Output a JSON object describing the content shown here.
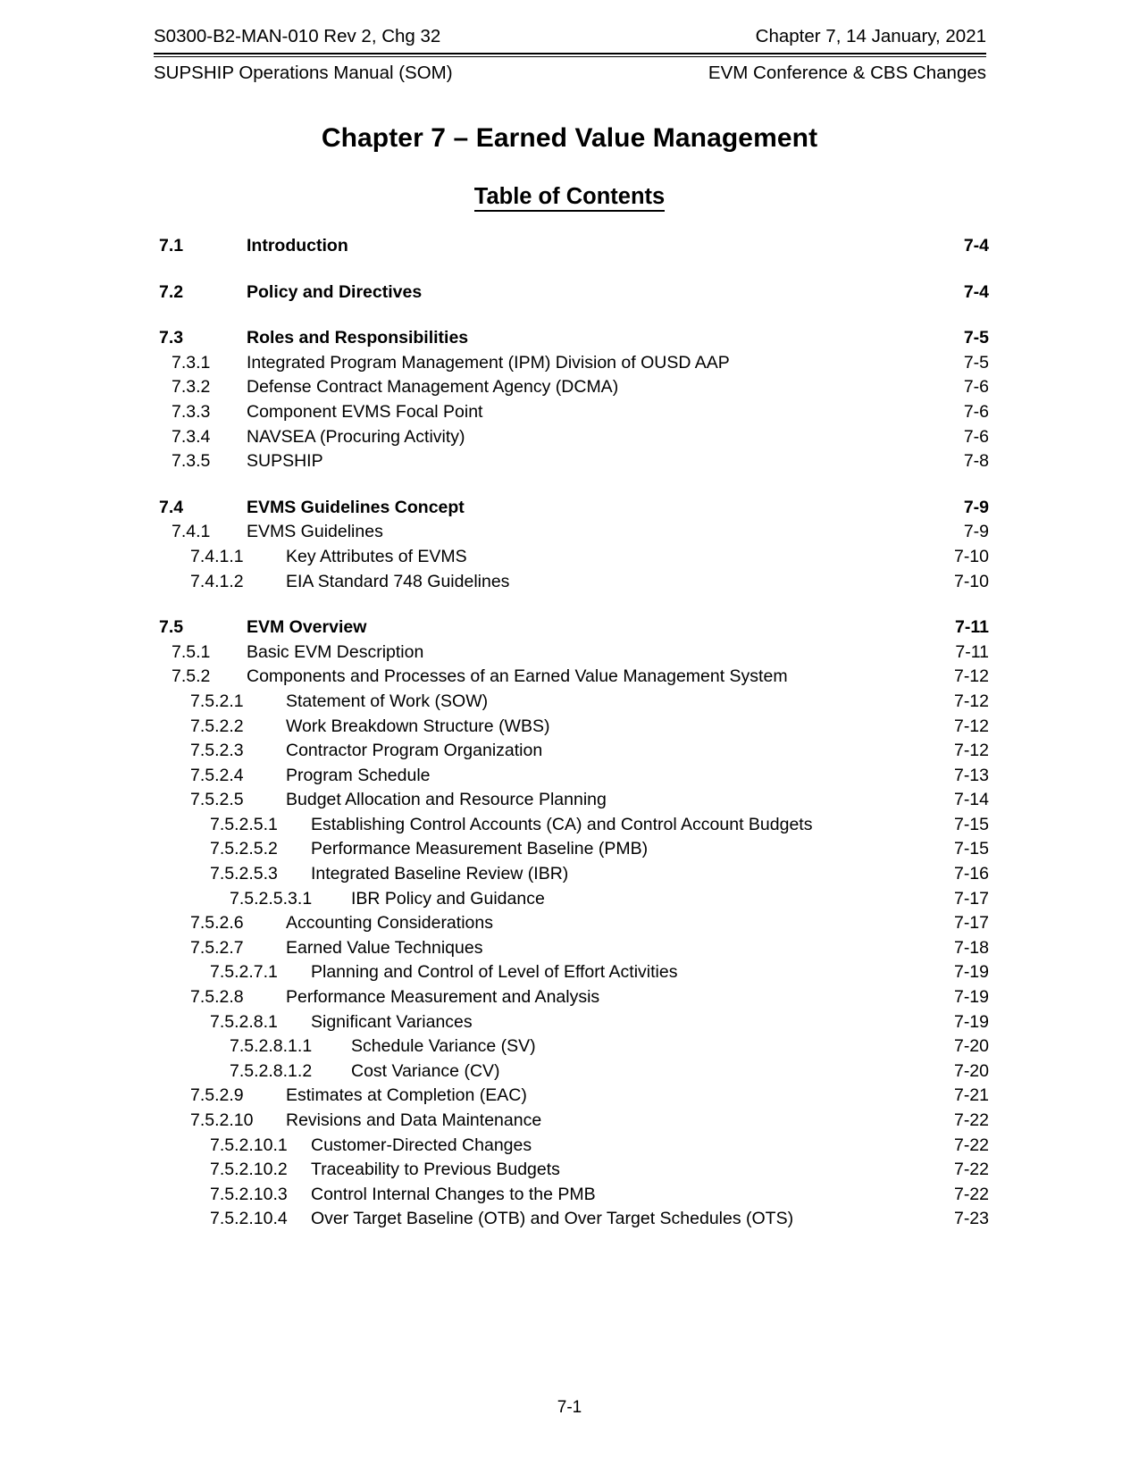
{
  "header": {
    "left_line1": "S0300-B2-MAN-010 Rev 2, Chg 32",
    "right_line1": "Chapter 7, 14 January, 2021",
    "left_line2": "SUPSHIP Operations Manual (SOM)",
    "right_line2": "EVM Conference & CBS Changes"
  },
  "title": {
    "chapter": "Chapter 7 – Earned Value Management",
    "toc_heading": "Table of Contents"
  },
  "toc": {
    "entries": [
      {
        "level": 1,
        "gap": false,
        "number": "7.1",
        "text": "Introduction",
        "page": "7-4"
      },
      {
        "level": 1,
        "gap": true,
        "number": "7.2",
        "text": "Policy and Directives",
        "page": "7-4"
      },
      {
        "level": 1,
        "gap": true,
        "number": "7.3",
        "text": "Roles and Responsibilities",
        "page": "7-5"
      },
      {
        "level": 2,
        "gap": false,
        "number": "7.3.1",
        "text": "Integrated Program Management (IPM) Division of OUSD AAP",
        "page": "7-5"
      },
      {
        "level": 2,
        "gap": false,
        "number": "7.3.2",
        "text": "Defense Contract Management Agency (DCMA)",
        "page": "7-6"
      },
      {
        "level": 2,
        "gap": false,
        "number": "7.3.3",
        "text": "Component EVMS Focal Point",
        "page": "7-6"
      },
      {
        "level": 2,
        "gap": false,
        "number": "7.3.4",
        "text": "NAVSEA (Procuring Activity)",
        "page": "7-6"
      },
      {
        "level": 2,
        "gap": false,
        "number": "7.3.5",
        "text": "SUPSHIP",
        "page": "7-8"
      },
      {
        "level": 1,
        "gap": true,
        "number": "7.4",
        "text": "EVMS Guidelines Concept",
        "page": "7-9"
      },
      {
        "level": 2,
        "gap": false,
        "number": "7.4.1",
        "text": "EVMS Guidelines",
        "page": "7-9"
      },
      {
        "level": 3,
        "gap": false,
        "number": "7.4.1.1",
        "text": "Key Attributes of EVMS",
        "page": "7-10"
      },
      {
        "level": 3,
        "gap": false,
        "number": "7.4.1.2",
        "text": "EIA Standard 748 Guidelines",
        "page": "7-10"
      },
      {
        "level": 1,
        "gap": true,
        "number": "7.5",
        "text": "EVM Overview",
        "page": "7-11"
      },
      {
        "level": 2,
        "gap": false,
        "number": "7.5.1",
        "text": "Basic EVM Description",
        "page": "7-11"
      },
      {
        "level": 2,
        "gap": false,
        "number": "7.5.2",
        "text": "Components and Processes of an Earned Value Management System",
        "page": "7-12"
      },
      {
        "level": 3,
        "gap": false,
        "number": "7.5.2.1",
        "text": "Statement of Work (SOW)",
        "page": "7-12"
      },
      {
        "level": 3,
        "gap": false,
        "number": "7.5.2.2",
        "text": "Work Breakdown Structure (WBS)",
        "page": "7-12"
      },
      {
        "level": 3,
        "gap": false,
        "number": "7.5.2.3",
        "text": "Contractor Program Organization",
        "page": "7-12"
      },
      {
        "level": 3,
        "gap": false,
        "number": "7.5.2.4",
        "text": "Program Schedule",
        "page": "7-13"
      },
      {
        "level": 3,
        "gap": false,
        "number": "7.5.2.5",
        "text": "Budget Allocation and Resource Planning",
        "page": "7-14"
      },
      {
        "level": 4,
        "gap": false,
        "number": "7.5.2.5.1",
        "text": "Establishing Control Accounts (CA) and Control Account Budgets",
        "page": "7-15"
      },
      {
        "level": 4,
        "gap": false,
        "number": "7.5.2.5.2",
        "text": "Performance Measurement Baseline (PMB)",
        "page": "7-15"
      },
      {
        "level": 4,
        "gap": false,
        "number": "7.5.2.5.3",
        "text": "Integrated Baseline Review (IBR)",
        "page": "7-16"
      },
      {
        "level": 5,
        "gap": false,
        "number": "7.5.2.5.3.1",
        "text": "IBR Policy and Guidance",
        "page": "7-17"
      },
      {
        "level": 3,
        "gap": false,
        "number": "7.5.2.6",
        "text": "Accounting Considerations",
        "page": "7-17"
      },
      {
        "level": 3,
        "gap": false,
        "number": "7.5.2.7",
        "text": "Earned Value Techniques",
        "page": "7-18"
      },
      {
        "level": 4,
        "gap": false,
        "number": "7.5.2.7.1",
        "text": "Planning and Control of Level of Effort Activities",
        "page": "7-19"
      },
      {
        "level": 3,
        "gap": false,
        "number": "7.5.2.8",
        "text": "Performance Measurement and Analysis",
        "page": "7-19"
      },
      {
        "level": 4,
        "gap": false,
        "number": "7.5.2.8.1",
        "text": "Significant Variances",
        "page": "7-19"
      },
      {
        "level": 5,
        "gap": false,
        "number": "7.5.2.8.1.1",
        "text": "Schedule Variance (SV)",
        "page": "7-20"
      },
      {
        "level": 5,
        "gap": false,
        "number": "7.5.2.8.1.2",
        "text": "Cost Variance (CV)",
        "page": "7-20"
      },
      {
        "level": 3,
        "gap": false,
        "number": "7.5.2.9",
        "text": "Estimates at Completion (EAC)",
        "page": "7-21"
      },
      {
        "level": 3,
        "gap": false,
        "number": "7.5.2.10",
        "text": "Revisions and Data Maintenance",
        "page": "7-22"
      },
      {
        "level": 4,
        "gap": false,
        "number": "7.5.2.10.1",
        "text": "Customer-Directed Changes",
        "page": "7-22"
      },
      {
        "level": 4,
        "gap": false,
        "number": "7.5.2.10.2",
        "text": "Traceability to Previous Budgets",
        "page": "7-22"
      },
      {
        "level": 4,
        "gap": false,
        "number": "7.5.2.10.3",
        "text": "Control Internal Changes to the PMB",
        "page": "7-22"
      },
      {
        "level": 4,
        "gap": false,
        "number": "7.5.2.10.4",
        "text": "Over Target Baseline (OTB) and Over Target Schedules (OTS)",
        "page": "7-23"
      }
    ]
  },
  "footer": {
    "page_number": "7-1"
  }
}
